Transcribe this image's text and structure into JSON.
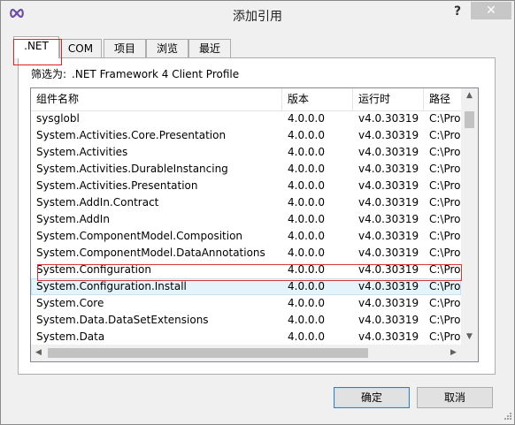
{
  "window": {
    "title": "添加引用",
    "help_label": "?",
    "close_label": "✕",
    "app_icon": "infinity-icon"
  },
  "tabs": [
    {
      "label": ".NET",
      "active": true
    },
    {
      "label": "COM",
      "active": false
    },
    {
      "label": "项目",
      "active": false
    },
    {
      "label": "浏览",
      "active": false
    },
    {
      "label": "最近",
      "active": false
    }
  ],
  "filter": {
    "label": "筛选为:",
    "value": ".NET Framework 4 Client Profile"
  },
  "table": {
    "columns": [
      "组件名称",
      "版本",
      "运行时",
      "路径"
    ],
    "rows": [
      {
        "name": "sysglobl",
        "version": "4.0.0.0",
        "runtime": "v4.0.30319",
        "path": "C:\\Pro"
      },
      {
        "name": "System.Activities.Core.Presentation",
        "version": "4.0.0.0",
        "runtime": "v4.0.30319",
        "path": "C:\\Pro"
      },
      {
        "name": "System.Activities",
        "version": "4.0.0.0",
        "runtime": "v4.0.30319",
        "path": "C:\\Pro"
      },
      {
        "name": "System.Activities.DurableInstancing",
        "version": "4.0.0.0",
        "runtime": "v4.0.30319",
        "path": "C:\\Pro"
      },
      {
        "name": "System.Activities.Presentation",
        "version": "4.0.0.0",
        "runtime": "v4.0.30319",
        "path": "C:\\Pro"
      },
      {
        "name": "System.AddIn.Contract",
        "version": "4.0.0.0",
        "runtime": "v4.0.30319",
        "path": "C:\\Pro"
      },
      {
        "name": "System.AddIn",
        "version": "4.0.0.0",
        "runtime": "v4.0.30319",
        "path": "C:\\Pro"
      },
      {
        "name": "System.ComponentModel.Composition",
        "version": "4.0.0.0",
        "runtime": "v4.0.30319",
        "path": "C:\\Pro"
      },
      {
        "name": "System.ComponentModel.DataAnnotations",
        "version": "4.0.0.0",
        "runtime": "v4.0.30319",
        "path": "C:\\Pro"
      },
      {
        "name": "System.Configuration",
        "version": "4.0.0.0",
        "runtime": "v4.0.30319",
        "path": "C:\\Pro"
      },
      {
        "name": "System.Configuration.Install",
        "version": "4.0.0.0",
        "runtime": "v4.0.30319",
        "path": "C:\\Pro"
      },
      {
        "name": "System.Core",
        "version": "4.0.0.0",
        "runtime": "v4.0.30319",
        "path": "C:\\Pro"
      },
      {
        "name": "System.Data.DataSetExtensions",
        "version": "4.0.0.0",
        "runtime": "v4.0.30319",
        "path": "C:\\Pro"
      },
      {
        "name": "System.Data",
        "version": "4.0.0.0",
        "runtime": "v4.0.30319",
        "path": "C:\\Pro"
      }
    ],
    "selected_row": "System.Configuration.Install",
    "highlighted_row": "System.Configuration"
  },
  "buttons": {
    "ok": "确定",
    "cancel": "取消"
  },
  "colors": {
    "annotation": "#e02020",
    "selected_row": "#e5f3fb",
    "close_button": "#c7c7c7"
  }
}
